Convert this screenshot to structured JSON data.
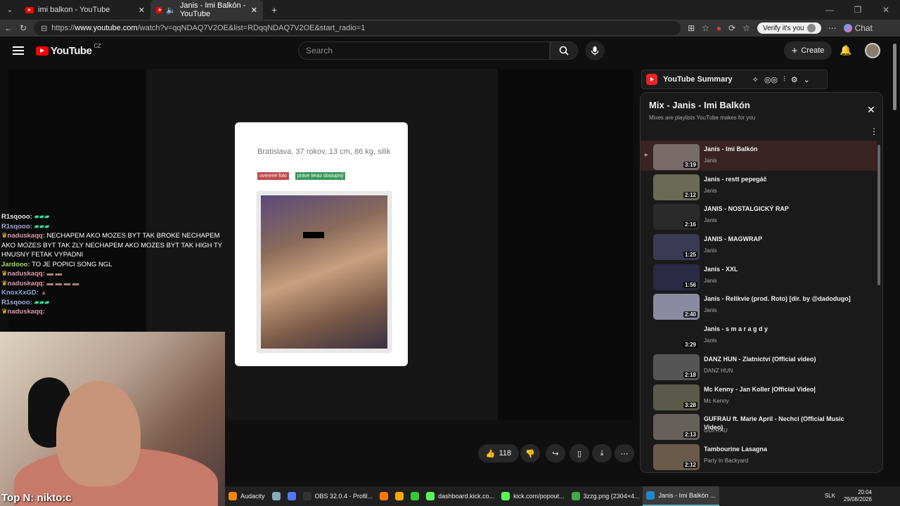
{
  "browser": {
    "tabs": [
      {
        "label": "imi balkon - YouTube"
      },
      {
        "label": "Janis - Imi Balkón - YouTube"
      }
    ],
    "url_prefix": "https://",
    "url_host": "www.youtube.com",
    "url_path": "/watch?v=qqNDAQ7V2OE&list=RDqqNDAQ7V2OE&start_radio=1",
    "verify_label": "Verify it's you",
    "chat_label": "Chat"
  },
  "youtube": {
    "logo": "YouTube",
    "region": "CZ",
    "search_placeholder": "Search",
    "create_label": "Create",
    "like_count": "118"
  },
  "video_card": {
    "location": "Bratislava, 37 rokov, 13 cm, 86 kg, silik",
    "badge_verified": "overené foto",
    "badge_available": "práve teraz dostupný"
  },
  "chat": [
    {
      "user": "R1sqooo:",
      "msg": "",
      "color": "#e8e8e8"
    },
    {
      "user": "R1sqooo:",
      "msg": "",
      "color": "#aad"
    },
    {
      "user": "naduskaqq:",
      "msg": "NECHAPEM AKO MOZES BYT TAK BROKE NECHAPEM AKO MOZES BYT TAK ZLY NECHAPEM AKO MOZES BYT TAK HIGH TY HNUSNY FETAK VYPADNI",
      "color": "#d9a"
    },
    {
      "user": "Jardooo:",
      "msg": "TO JE POPICI SONG NGL",
      "color": "#9d6"
    },
    {
      "user": "naduskaqq:",
      "msg": "",
      "color": "#d9a"
    },
    {
      "user": "naduskaqq:",
      "msg": "",
      "color": "#d9a"
    },
    {
      "user": "KnoxXxGD:",
      "msg": "",
      "color": "#8ad"
    },
    {
      "user": "R1sqooo:",
      "msg": "",
      "color": "#aad"
    },
    {
      "user": "naduskaqq:",
      "msg": "",
      "color": "#d9a"
    }
  ],
  "overlay": {
    "top_n": "Top N: nikto:c"
  },
  "summary": {
    "label": "YouTube Summary"
  },
  "mix": {
    "title": "Mix - Janis - Imi Balkón",
    "subtitle": "Mixes are playlists YouTube makes for you",
    "items": [
      {
        "title": "Janis - Imi Balkón",
        "channel": "Janis",
        "duration": "3:19",
        "thumb": "#7a6b6b"
      },
      {
        "title": "Janis - restt pepegáč",
        "channel": "Janis",
        "duration": "2:12",
        "thumb": "#6a6a55"
      },
      {
        "title": "JANIS - NOSTALGICKÝ RAP",
        "channel": "Janis",
        "duration": "2:16",
        "thumb": "#2a2a2a"
      },
      {
        "title": "JANIS - MAGWRAP",
        "channel": "Janis",
        "duration": "1:25",
        "thumb": "#3a3a55"
      },
      {
        "title": "Janis - XXL",
        "channel": "Janis",
        "duration": "1:56",
        "thumb": "#2a2a44"
      },
      {
        "title": "Janis - Relikvie (prod. Roto) [dir. by @dadodugo]",
        "channel": "Janis",
        "duration": "2:40",
        "thumb": "#8a8aa0"
      },
      {
        "title": "Janis - s m a r a g d y",
        "channel": "Janis",
        "duration": "3:29",
        "thumb": "#1a1a1a"
      },
      {
        "title": "DANZ HUN - Zlatnictví (Official video)",
        "channel": "DANZ HUN",
        "duration": "2:18",
        "thumb": "#555"
      },
      {
        "title": "Mc Kenny - Jan Koller |Official Video|",
        "channel": "Mc Kenny",
        "duration": "3:28",
        "thumb": "#5a5a4a"
      },
      {
        "title": "GUFRAU ft. Marie April - Nechci (Official Music Video)",
        "channel": "GUFRAU",
        "duration": "2:13",
        "thumb": "#66605a"
      },
      {
        "title": "Tambourine Lasagna",
        "channel": "Party In Backyard",
        "duration": "2:12",
        "thumb": "#6a5a4a"
      }
    ]
  },
  "taskbar": {
    "items": [
      {
        "label": "Audacity",
        "color": "#f80"
      },
      {
        "label": "",
        "color": "#8ab"
      },
      {
        "label": "",
        "color": "#57f"
      },
      {
        "label": "OBS 32.0.4 - Profil...",
        "color": "#333"
      },
      {
        "label": "",
        "color": "#f70"
      },
      {
        "label": "",
        "color": "#fa0"
      },
      {
        "label": "",
        "color": "#3c3"
      },
      {
        "label": "dashboard.kick.co...",
        "color": "#5f5"
      },
      {
        "label": "kick.com/popout...",
        "color": "#5f5"
      },
      {
        "label": "3zzg.png (2304×4...",
        "color": "#4a4"
      },
      {
        "label": "Janis - Imi Balkón ...",
        "color": "#28c"
      }
    ],
    "lang": "SLK",
    "time": "20:04",
    "date": "29/08/2026"
  }
}
